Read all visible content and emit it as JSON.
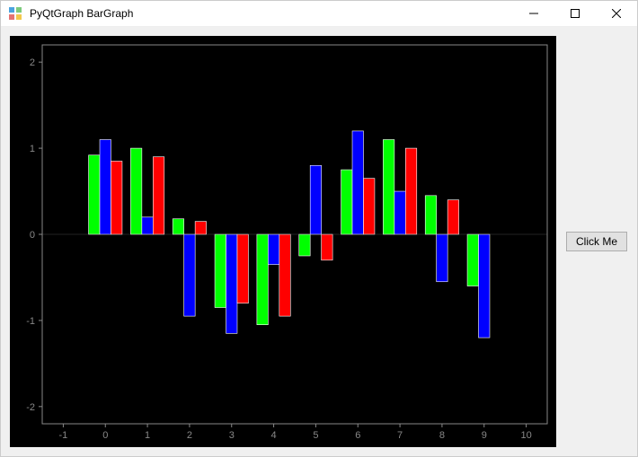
{
  "window": {
    "title": "PyQtGraph BarGraph",
    "controls": {
      "minimize": "minimize",
      "maximize": "maximize",
      "close": "close"
    }
  },
  "side_panel": {
    "button_label": "Click Me"
  },
  "chart_data": {
    "type": "bar",
    "title": "",
    "xlabel": "",
    "ylabel": "",
    "x_ticks": [
      -1,
      0,
      1,
      2,
      3,
      4,
      5,
      6,
      7,
      8,
      9,
      10
    ],
    "y_ticks": [
      -2,
      -1,
      0,
      1,
      2
    ],
    "xlim": [
      -1.5,
      10.5
    ],
    "ylim": [
      -2.2,
      2.2
    ],
    "x": [
      0,
      1,
      2,
      3,
      4,
      5,
      6,
      7,
      8,
      9
    ],
    "series": [
      {
        "name": "green",
        "color": "#00ff00",
        "offset": -0.266,
        "values": [
          0.92,
          1.0,
          0.18,
          -0.85,
          -1.05,
          -0.25,
          0.75,
          1.1,
          0.45,
          -0.6
        ]
      },
      {
        "name": "blue",
        "color": "#0000ff",
        "offset": 0.0,
        "values": [
          1.1,
          0.2,
          -0.95,
          -1.15,
          -0.35,
          0.8,
          1.2,
          0.5,
          -0.55,
          -1.2
        ]
      },
      {
        "name": "red",
        "color": "#ff0000",
        "offset": 0.266,
        "values": [
          0.85,
          0.9,
          0.15,
          -0.8,
          -0.95,
          -0.3,
          0.65,
          1.0,
          0.4,
          0.0
        ]
      }
    ],
    "bar_width": 0.266
  }
}
